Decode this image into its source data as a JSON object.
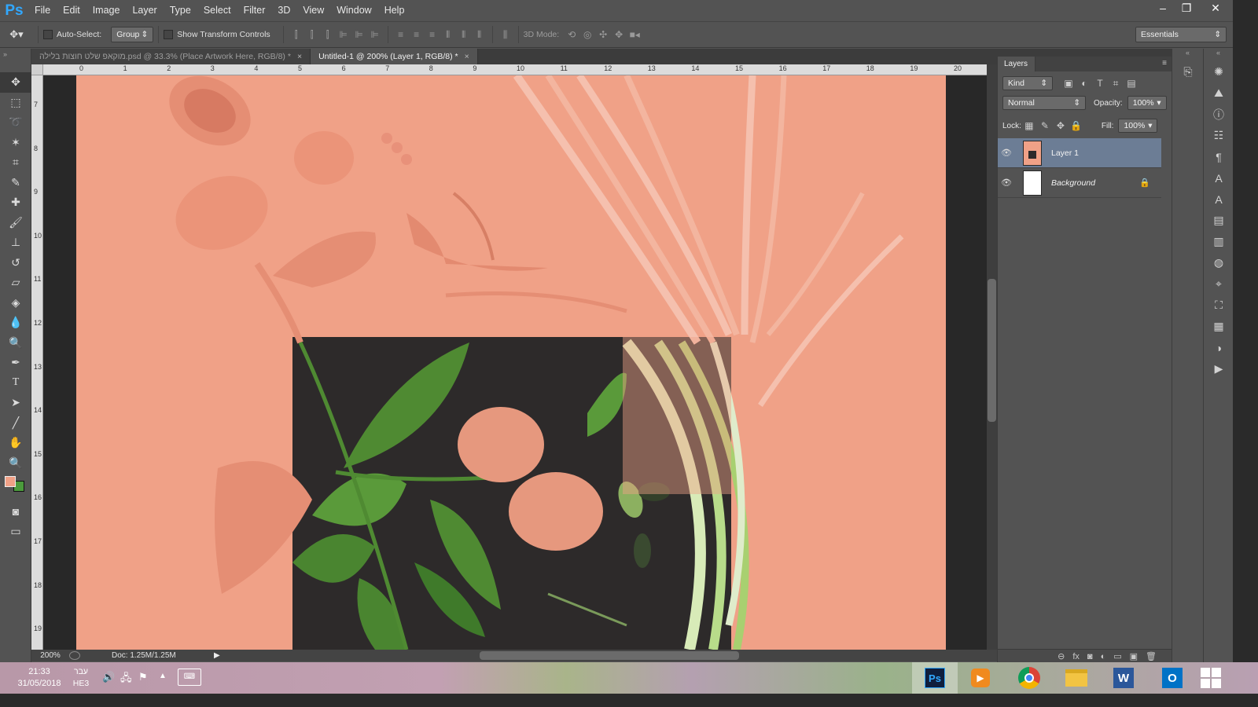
{
  "app": {
    "logo": "Ps",
    "brand_color": "#31a8ff"
  },
  "menu": [
    "File",
    "Edit",
    "Image",
    "Layer",
    "Type",
    "Select",
    "Filter",
    "3D",
    "View",
    "Window",
    "Help"
  ],
  "window_controls": {
    "minimize": "–",
    "restore": "❐",
    "close": "✕"
  },
  "options_bar": {
    "auto_select_label": "Auto-Select:",
    "auto_select_value": "Group",
    "show_transform_label": "Show Transform Controls",
    "mode_3d_label": "3D Mode:",
    "workspace": "Essentials"
  },
  "tabs": [
    {
      "label": "מוקאפ שלט חוצות בלילה.psd @ 33.3% (Place Artwork Here, RGB/8) *",
      "close": "×"
    },
    {
      "label": "Untitled-1 @ 200% (Layer 1, RGB/8) *",
      "close": "×"
    }
  ],
  "tools": [
    "move-tool-icon",
    "marquee-tool-icon",
    "lasso-tool-icon",
    "magic-wand-icon",
    "crop-tool-icon",
    "eyedropper-icon",
    "healing-brush-icon",
    "brush-tool-icon",
    "clone-stamp-icon",
    "history-brush-icon",
    "eraser-icon",
    "paint-bucket-icon",
    "blur-tool-icon",
    "dodge-tool-icon",
    "pen-tool-icon",
    "type-tool-icon",
    "path-selection-icon",
    "line-tool-icon",
    "hand-tool-icon",
    "zoom-tool-icon"
  ],
  "colors": {
    "foreground": "#f0a187",
    "background": "#4b9a3c"
  },
  "hruler_ticks": [
    "0",
    "1",
    "2",
    "3",
    "4",
    "5",
    "6",
    "7",
    "8",
    "9",
    "10",
    "11",
    "12",
    "13",
    "14",
    "15",
    "16",
    "17",
    "18",
    "19",
    "20"
  ],
  "vruler_ticks": [
    "7",
    "8",
    "9",
    "10",
    "11",
    "12",
    "13",
    "14",
    "15",
    "16",
    "17",
    "18",
    "19"
  ],
  "status": {
    "zoom": "200%",
    "doc": "Doc: 1.25M/1.25M"
  },
  "layers_panel": {
    "title": "Layers",
    "filter_kind": "Kind",
    "blend_mode": "Normal",
    "opacity_label": "Opacity:",
    "opacity_value": "100%",
    "lock_label": "Lock:",
    "fill_label": "Fill:",
    "fill_value": "100%",
    "layers": [
      {
        "name": "Layer 1",
        "selected": true
      },
      {
        "name": "Background",
        "selected": false,
        "locked": true
      }
    ]
  },
  "taskbar": {
    "time": "21:33",
    "date": "31/05/2018",
    "lang_top": "עבר",
    "lang_bottom": "HE3",
    "apps": [
      "photoshop-icon",
      "media-player-icon",
      "chrome-icon",
      "file-explorer-icon",
      "word-icon",
      "outlook-icon",
      "windows-start-icon"
    ]
  }
}
